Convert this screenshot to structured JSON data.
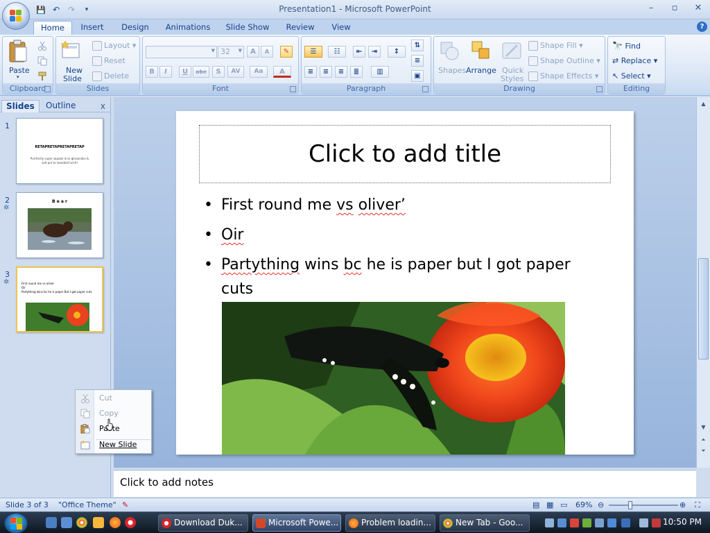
{
  "window": {
    "title": "Presentation1 - Microsoft PowerPoint",
    "minimize": "–",
    "maximize": "▫",
    "close": "✕"
  },
  "qat": {
    "save": "💾",
    "undo": "↶",
    "redo": "↷",
    "more": "▾"
  },
  "tabs": [
    "Home",
    "Insert",
    "Design",
    "Animations",
    "Slide Show",
    "Review",
    "View"
  ],
  "active_tab": "Home",
  "help": "?",
  "ribbon": {
    "clipboard": {
      "label": "Clipboard",
      "paste": "Paste"
    },
    "slides": {
      "label": "Slides",
      "new_slide_1": "New",
      "new_slide_2": "Slide",
      "layout": "Layout",
      "reset": "Reset",
      "delete": "Delete"
    },
    "font": {
      "label": "Font",
      "size": "32",
      "bold": "B",
      "italic": "I",
      "underline": "U",
      "strike": "abc",
      "shadow": "S",
      "spacing": "AV",
      "case": "Aa",
      "color": "A",
      "grow": "A",
      "shrink": "A"
    },
    "paragraph": {
      "label": "Paragraph"
    },
    "drawing": {
      "label": "Drawing",
      "shapes": "Shapes",
      "arrange": "Arrange",
      "quick_styles_1": "Quick",
      "quick_styles_2": "Styles",
      "shape_fill": "Shape Fill",
      "shape_outline": "Shape Outline",
      "shape_effects": "Shape Effects"
    },
    "editing": {
      "label": "Editing",
      "find": "Find",
      "replace": "Replace",
      "select": "Select"
    }
  },
  "left_pane": {
    "tab_slides": "Slides",
    "tab_outline": "Outline",
    "close": "x",
    "thumbs": [
      {
        "num": "1",
        "title": "RETAPRETAPRETAPRETAP",
        "sub": "Purrfectly super squalor & to glissandos & salt pro to (avoided lurch)"
      },
      {
        "num": "2",
        "title": "B e a r"
      },
      {
        "num": "3",
        "bullets": [
          "First round me vs oliver",
          "Oir",
          "Partything wins bc he is paper But I got paper cuts"
        ]
      }
    ]
  },
  "slide": {
    "title_placeholder": "Click to add title",
    "bullets": [
      {
        "pre": "First round me ",
        "spell1": "vs",
        "mid": " ",
        "spell2": "oliver’",
        "post": ""
      },
      {
        "pre": "",
        "spell1": "Oir",
        "mid": "",
        "spell2": "",
        "post": ""
      },
      {
        "pre": "",
        "spell1": "Partything",
        "mid": " wins ",
        "spell2": "bc",
        "post": " he is paper but I got paper cuts"
      }
    ],
    "bullet_char": "•"
  },
  "notes": {
    "placeholder": "Click to add notes"
  },
  "status": {
    "slide_count": "Slide 3 of 3",
    "theme": "\"Office Theme\"",
    "zoom": "69%"
  },
  "context_menu": {
    "cut": "Cut",
    "copy": "Copy",
    "paste": "Paste",
    "new_slide": "New Slide"
  },
  "taskbar": {
    "items": [
      "Download Duk...",
      "Microsoft Powe...",
      "Problem loadin...",
      "New Tab - Goo..."
    ],
    "time": "10:50 PM"
  },
  "colors": {
    "accent": "#15428b",
    "ribbon_bg": "#dde8f6",
    "orange_highlight": "#f8c45a"
  }
}
